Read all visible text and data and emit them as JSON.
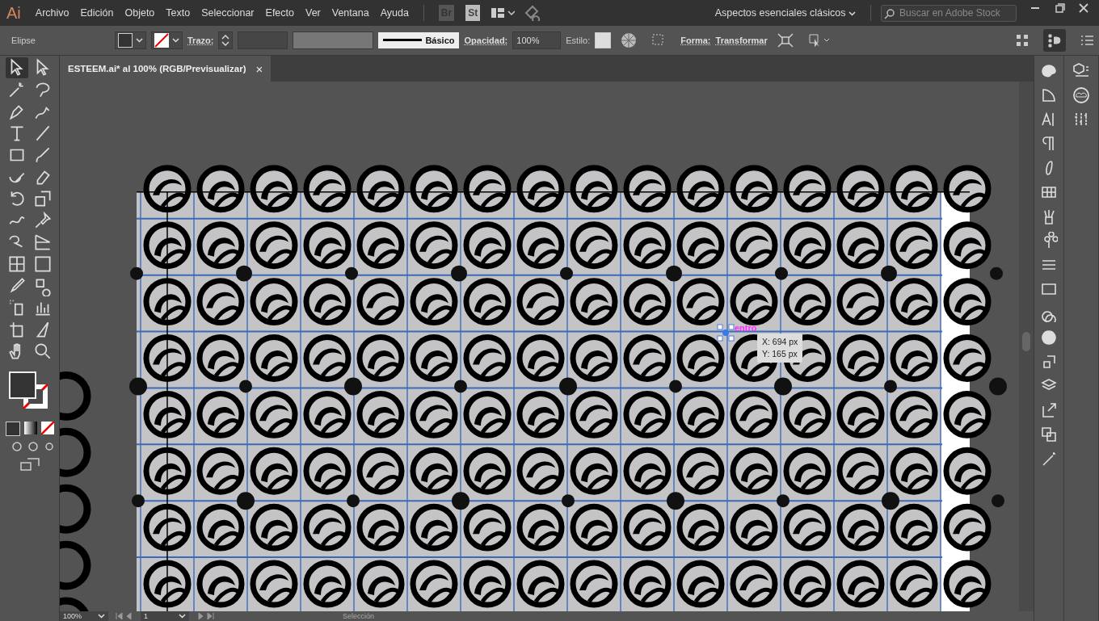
{
  "app": {
    "logo": "Ai"
  },
  "menu": [
    "Archivo",
    "Edición",
    "Objeto",
    "Texto",
    "Seleccionar",
    "Efecto",
    "Ver",
    "Ventana",
    "Ayuda"
  ],
  "app_bar": {
    "bridge": "Br",
    "stock": "St",
    "workspace": "Aspectos esenciales clásicos",
    "search": {
      "placeholder": "Buscar en Adobe Stock"
    }
  },
  "control_bar": {
    "object": "Elipse",
    "stroke_label": "Trazo:",
    "brush": "Básico",
    "opacity_label": "Opacidad:",
    "opacity": "100%",
    "style_label": "Estilo:",
    "shape_link": "Forma:",
    "transform_link": "Transformar"
  },
  "document_tab": {
    "title": "ESTEEM.ai* al 100% (RGB/Previsualizar)",
    "close": "×"
  },
  "canvas": {
    "snap_hint": "entro",
    "tooltip": [
      "X: 694 px",
      "Y: 165 px"
    ]
  },
  "status_bar": {
    "zoom": "100%",
    "artboard": "1",
    "tool": "Selección"
  }
}
